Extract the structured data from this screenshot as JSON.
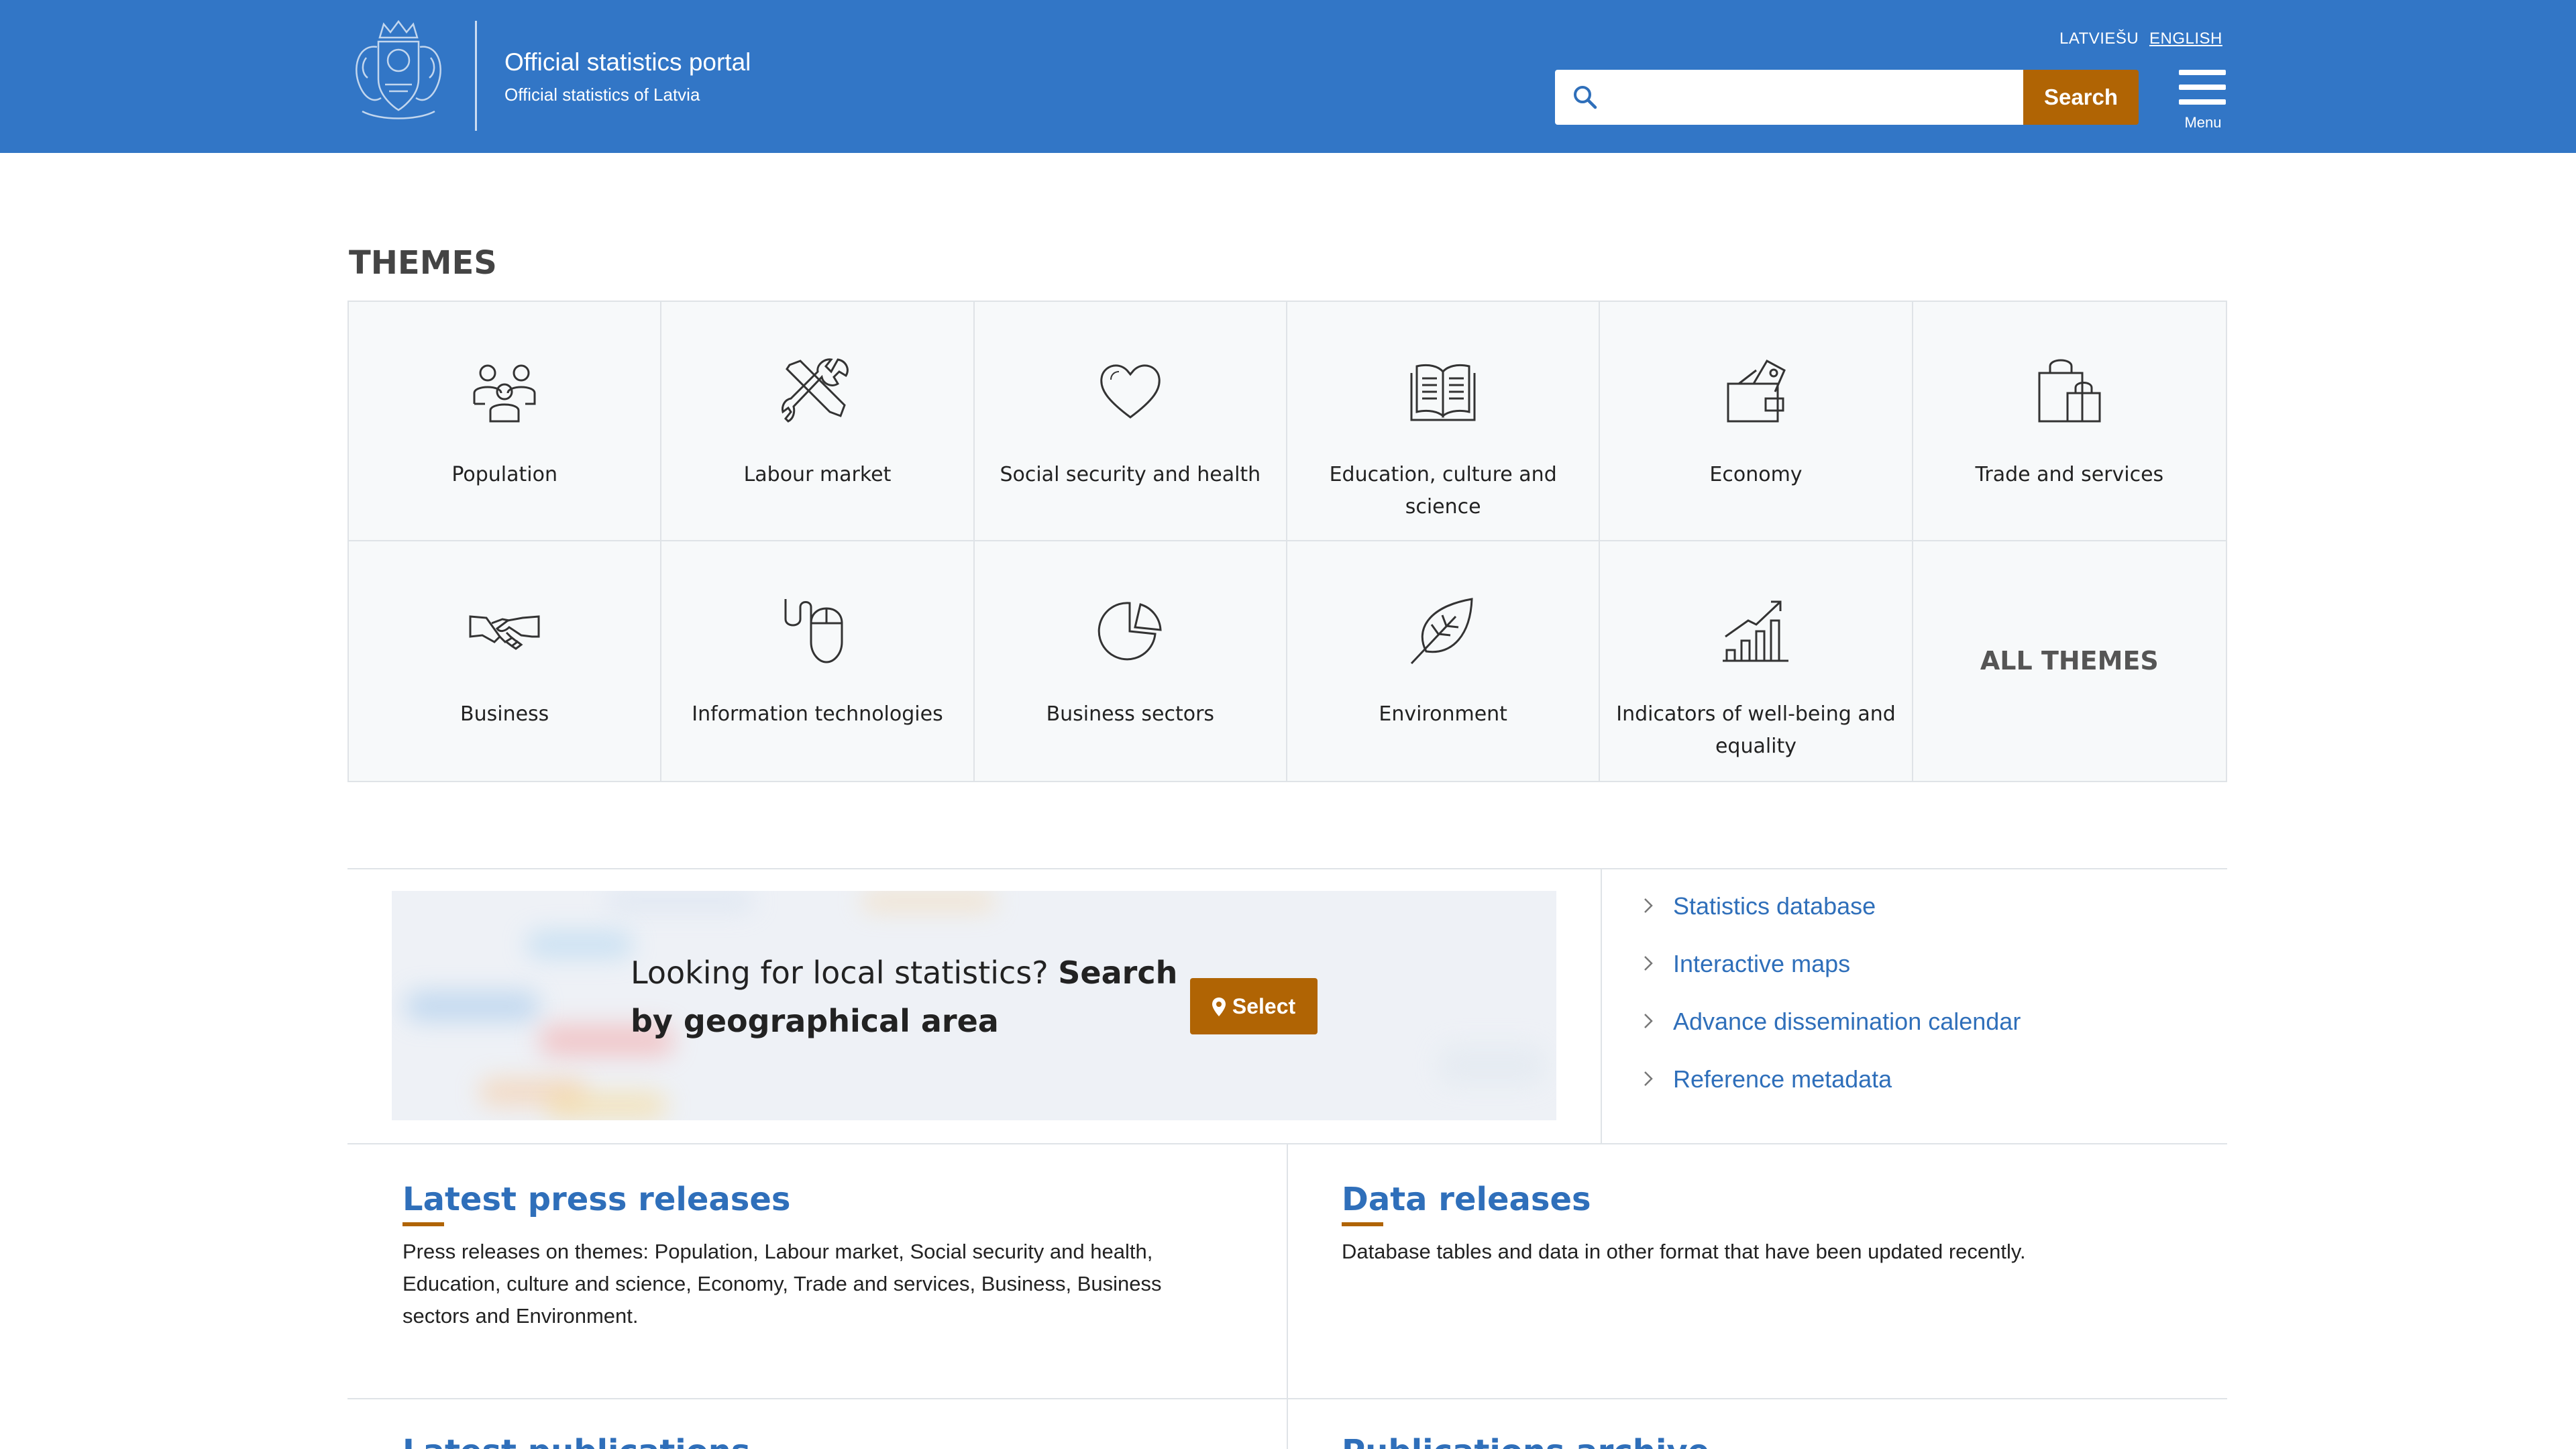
{
  "header": {
    "title": "Official statistics portal",
    "subtitle": "Official statistics of Latvia",
    "languages": [
      "LATVIEŠU",
      "ENGLISH"
    ],
    "active_language": "ENGLISH",
    "search_placeholder": "",
    "search_value": "",
    "search_button": "Search",
    "menu_label": "Menu",
    "brand_color": "#3276c6",
    "accent_color": "#b06404"
  },
  "themes": {
    "heading": "THEMES",
    "items": [
      {
        "label": "Population",
        "icon": "people-icon"
      },
      {
        "label": "Labour market",
        "icon": "tools-icon"
      },
      {
        "label": "Social security and health",
        "icon": "heart-icon"
      },
      {
        "label": "Education, culture and science",
        "icon": "book-icon"
      },
      {
        "label": "Economy",
        "icon": "wallet-icon"
      },
      {
        "label": "Trade and services",
        "icon": "shopping-bags-icon"
      },
      {
        "label": "Business",
        "icon": "handshake-icon"
      },
      {
        "label": "Information technologies",
        "icon": "mouse-icon"
      },
      {
        "label": "Business sectors",
        "icon": "pie-chart-icon"
      },
      {
        "label": "Environment",
        "icon": "leaf-icon"
      },
      {
        "label": "Indicators of well-being and equality",
        "icon": "growth-chart-icon"
      }
    ],
    "all_themes": "ALL THEMES"
  },
  "local_stats": {
    "text_plain": "Looking for local statistics?",
    "text_bold": "Search by geographical area",
    "button": "Select"
  },
  "quick_links": [
    "Statistics database",
    "Interactive maps",
    "Advance dissemination calendar",
    "Reference metadata"
  ],
  "releases": [
    {
      "title": "Latest press releases",
      "text": "Press releases on themes: Population, Labour market, Social security and health, Education, culture and science, Economy, Trade and services, Business, Business sectors and Environment."
    },
    {
      "title": "Data releases",
      "text": "Database tables and data in other format that have been updated recently."
    }
  ],
  "cutoff_titles": [
    "Latest publications",
    "Publications archive"
  ]
}
